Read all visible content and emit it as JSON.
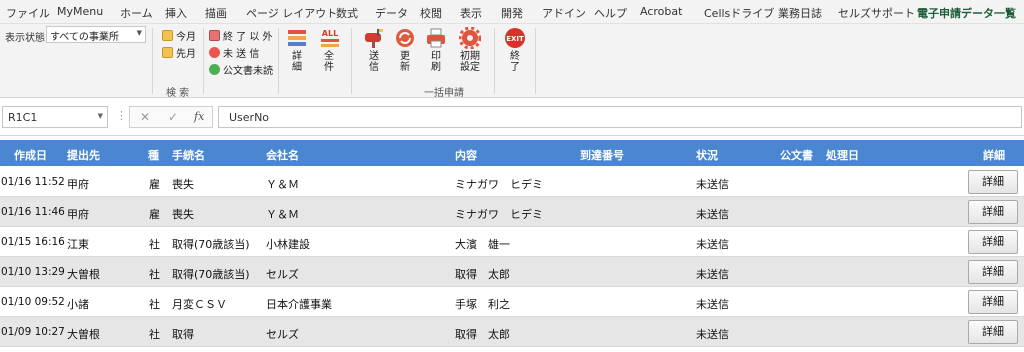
{
  "menu_tabs": [
    "ファイル",
    "MyMenu",
    "ホーム",
    "挿入",
    "描画",
    "ページ レイアウト",
    "数式",
    "データ",
    "校閲",
    "表示",
    "開発",
    "アドイン",
    "ヘルプ",
    "Acrobat",
    "Cellsドライブ",
    "業務日誌",
    "セルズサポート",
    "電子申請データ一覧"
  ],
  "active_tab": "電子申請データ一覧",
  "ribbon": {
    "status_label": "表示状態",
    "status_value": "すべての事業所",
    "this_month": "今月",
    "last_month": "先月",
    "not_finished": "終 了 以 外",
    "not_sent": "未 送 信",
    "unread_notice": "公文書未読",
    "detail": [
      "詳",
      "細"
    ],
    "all": [
      "全",
      "件"
    ],
    "search_group": "検 索",
    "send": [
      "送",
      "信"
    ],
    "update": [
      "更",
      "新"
    ],
    "print": [
      "印",
      "刷"
    ],
    "init_settings": [
      "初期",
      "設定"
    ],
    "exit": [
      "終",
      "了"
    ],
    "bulk_group": "一括申請",
    "all_icon_text": "ALL",
    "exit_icon_text": "EXIT"
  },
  "formula_bar": {
    "name_box": "R1C1",
    "fx": "fx",
    "value": "UserNo"
  },
  "table": {
    "headers": {
      "created": "作成日",
      "destination": "提出先",
      "kind": "種",
      "procedure": "手続名",
      "company": "会社名",
      "content": "内容",
      "arrival_no": "到達番号",
      "status": "状況",
      "official_doc": "公文書",
      "processed": "処理日",
      "detail": "詳細"
    },
    "detail_button": "詳細",
    "rows": [
      {
        "date": "01/16 11:52",
        "dest": "甲府",
        "kind": "雇",
        "proc": "喪失",
        "company": "Ｙ＆Ｍ",
        "content": "ミナガワ　ヒデミ",
        "status": "未送信"
      },
      {
        "date": "01/16 11:46",
        "dest": "甲府",
        "kind": "雇",
        "proc": "喪失",
        "company": "Ｙ＆Ｍ",
        "content": "ミナガワ　ヒデミ",
        "status": "未送信"
      },
      {
        "date": "01/15 16:16",
        "dest": "江東",
        "kind": "社",
        "proc": "取得(70歳該当)",
        "company": "小林建設",
        "content": "大濱　雄一",
        "status": "未送信"
      },
      {
        "date": "01/10 13:29",
        "dest": "大曽根",
        "kind": "社",
        "proc": "取得(70歳該当)",
        "company": "セルズ",
        "content": "取得　太郎",
        "status": "未送信"
      },
      {
        "date": "01/10 09:52",
        "dest": "小諸",
        "kind": "社",
        "proc": "月変ＣＳＶ",
        "company": "日本介護事業",
        "content": "手塚　利之",
        "status": "未送信"
      },
      {
        "date": "01/09 10:27",
        "dest": "大曽根",
        "kind": "社",
        "proc": "取得",
        "company": "セルズ",
        "content": "取得　太郎",
        "status": "未送信"
      }
    ]
  }
}
